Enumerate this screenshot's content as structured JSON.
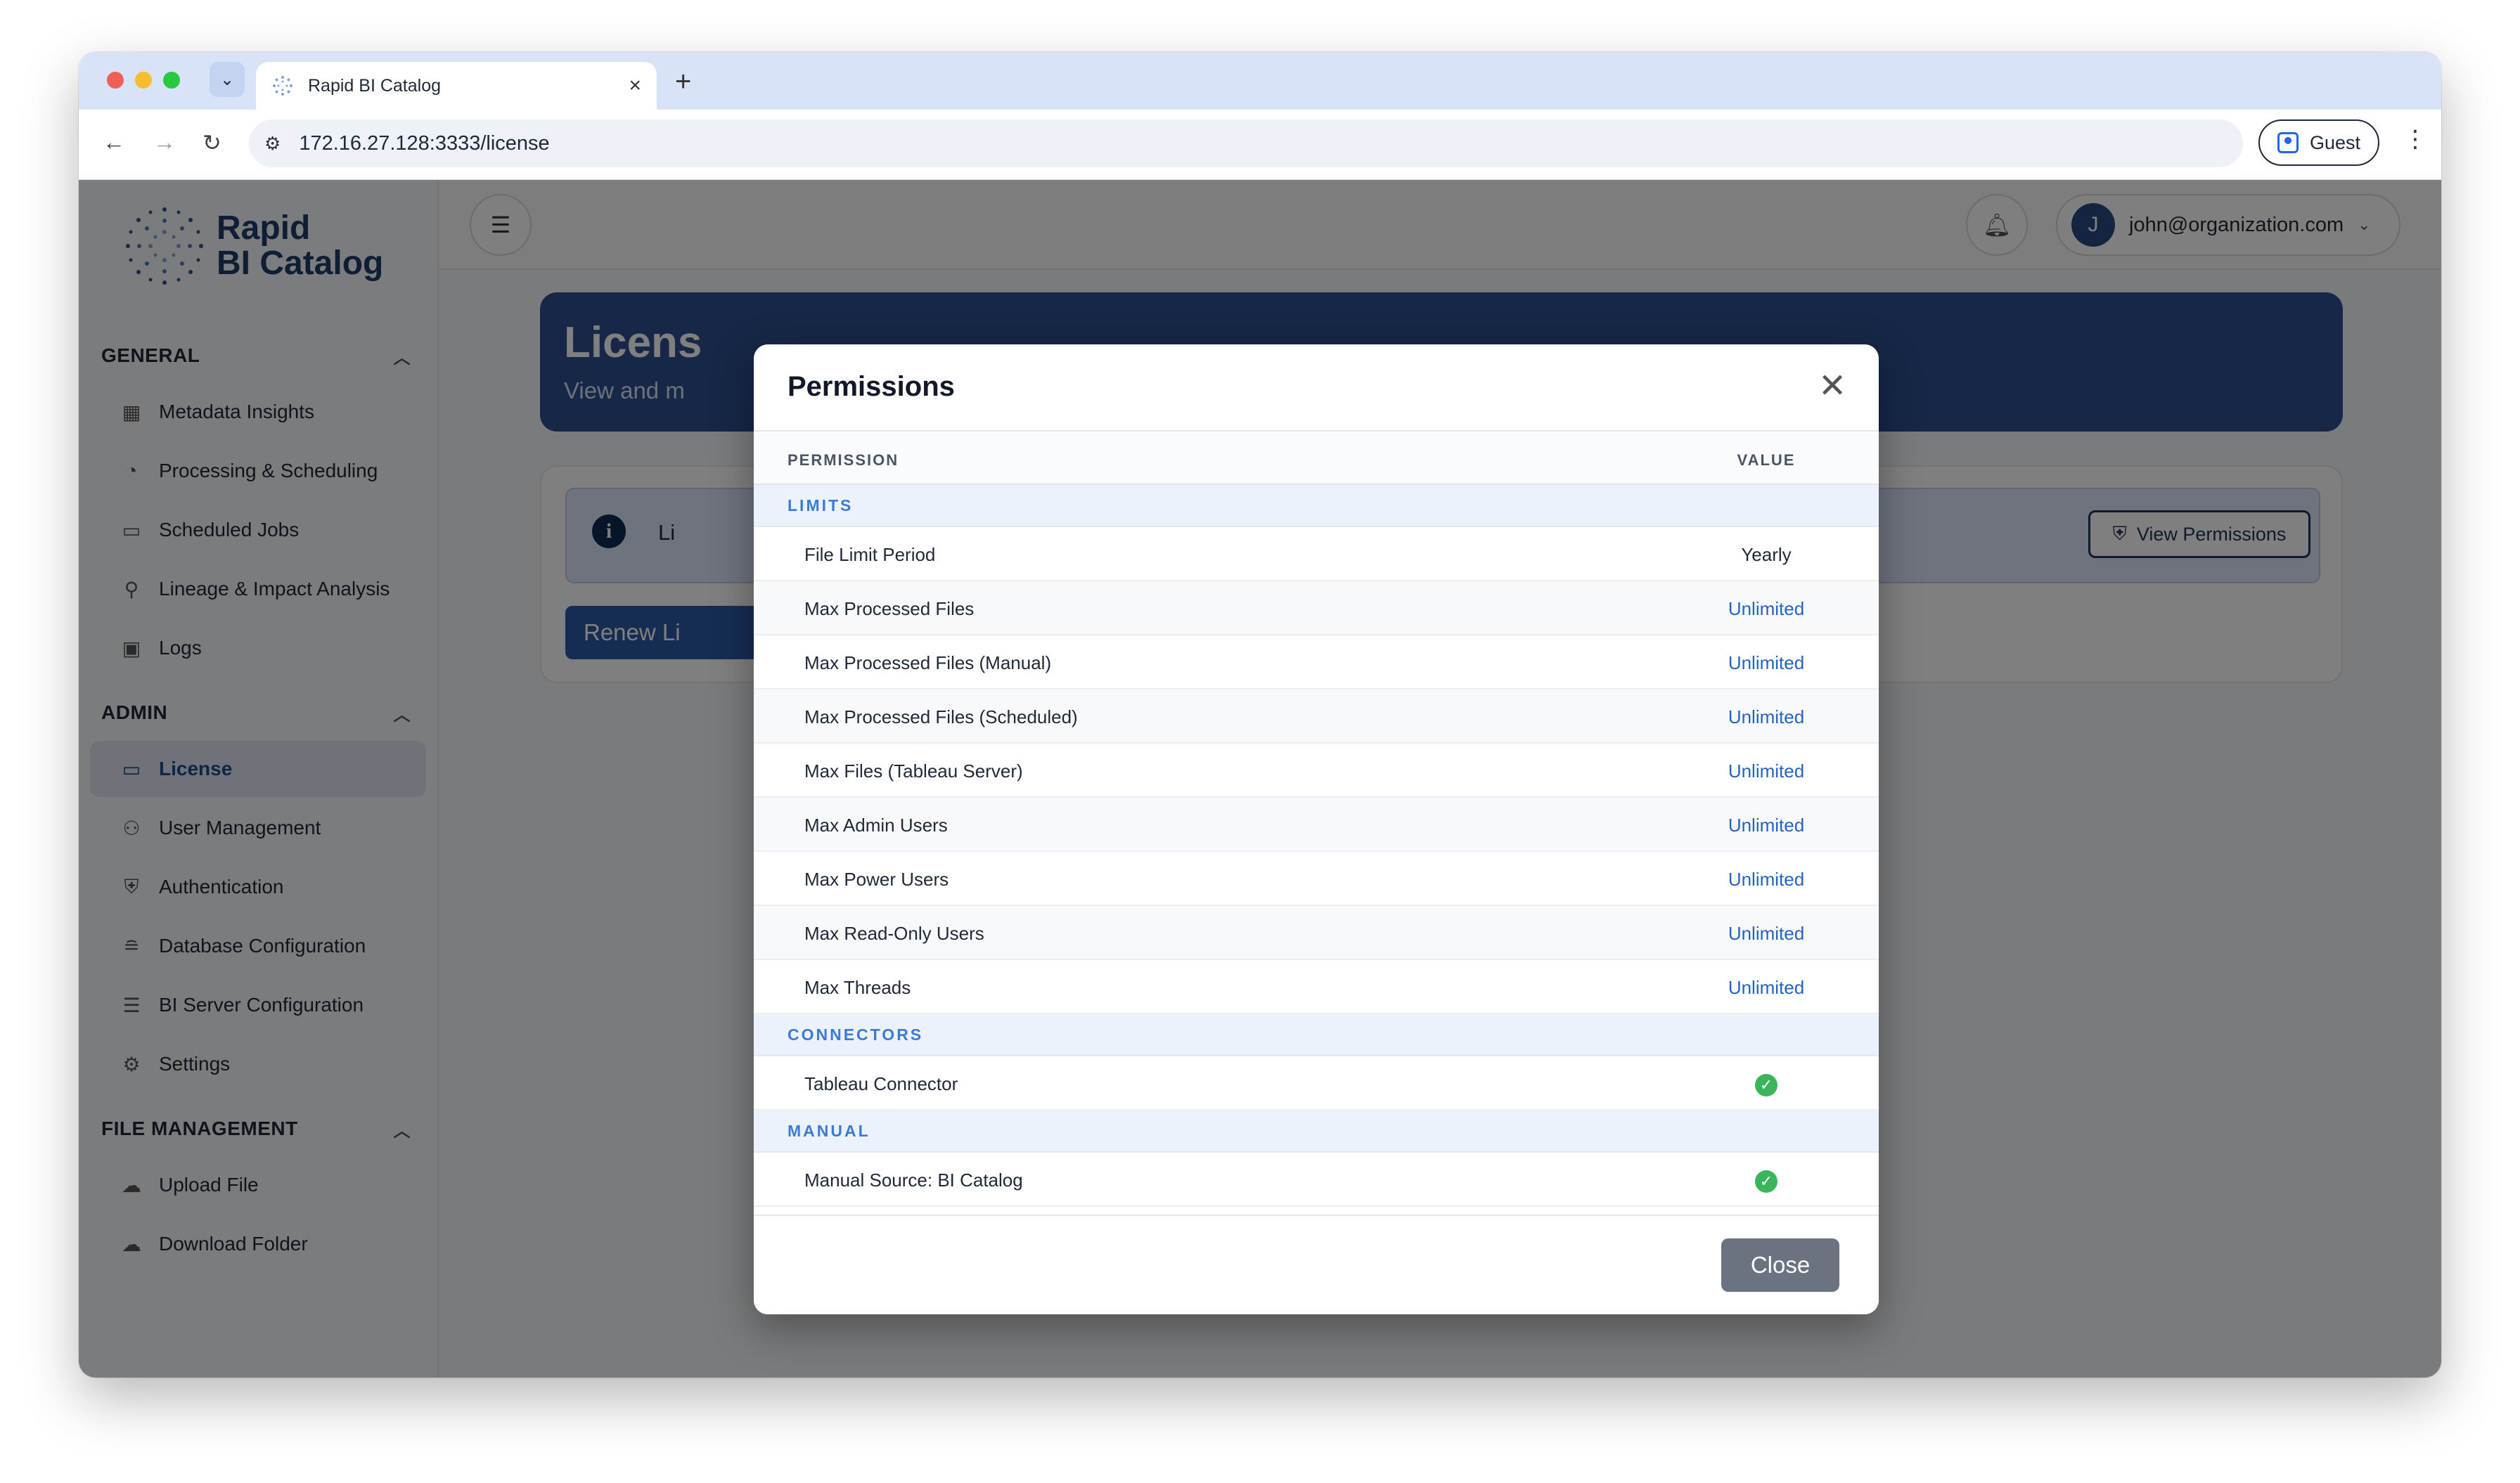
{
  "browser": {
    "tab_title": "Rapid BI Catalog",
    "url": "172.16.27.128:3333/license",
    "profile_label": "Guest"
  },
  "brand": {
    "line1": "Rapid",
    "line2": "BI Catalog"
  },
  "sidebar": {
    "sections": [
      {
        "title": "GENERAL",
        "items": [
          "Metadata Insights",
          "Processing & Scheduling",
          "Scheduled Jobs",
          "Lineage & Impact Analysis",
          "Logs"
        ]
      },
      {
        "title": "ADMIN",
        "items": [
          "License",
          "User Management",
          "Authentication",
          "Database Configuration",
          "BI Server Configuration",
          "Settings"
        ]
      },
      {
        "title": "FILE MANAGEMENT",
        "items": [
          "Upload File",
          "Download Folder"
        ]
      }
    ],
    "active_item": "License"
  },
  "header": {
    "user_initial": "J",
    "user_email": "john@organization.com"
  },
  "page": {
    "hero_title": "Licens",
    "hero_sub": "View and m",
    "info_text": "Li",
    "view_permissions_label": "View Permissions",
    "renew_label": "Renew Li"
  },
  "modal": {
    "title": "Permissions",
    "col_permission": "PERMISSION",
    "col_value": "VALUE",
    "groups": [
      {
        "name": "LIMITS",
        "rows": [
          {
            "name": "File Limit Period",
            "value": "Yearly"
          },
          {
            "name": "Max Processed Files",
            "value": "Unlimited"
          },
          {
            "name": "Max Processed Files (Manual)",
            "value": "Unlimited"
          },
          {
            "name": "Max Processed Files (Scheduled)",
            "value": "Unlimited"
          },
          {
            "name": "Max Files (Tableau Server)",
            "value": "Unlimited"
          },
          {
            "name": "Max Admin Users",
            "value": "Unlimited"
          },
          {
            "name": "Max Power Users",
            "value": "Unlimited"
          },
          {
            "name": "Max Read-Only Users",
            "value": "Unlimited"
          },
          {
            "name": "Max Threads",
            "value": "Unlimited"
          }
        ]
      },
      {
        "name": "CONNECTORS",
        "rows": [
          {
            "name": "Tableau Connector",
            "value": "check"
          }
        ]
      },
      {
        "name": "MANUAL",
        "rows": [
          {
            "name": "Manual Source: BI Catalog",
            "value": "check"
          }
        ]
      }
    ],
    "close_label": "Close"
  },
  "colors": {
    "brand_navy": "#2c4f8e",
    "link_blue": "#2463c4",
    "group_label": "#3b7bd5",
    "check_green": "#3bb55a"
  }
}
